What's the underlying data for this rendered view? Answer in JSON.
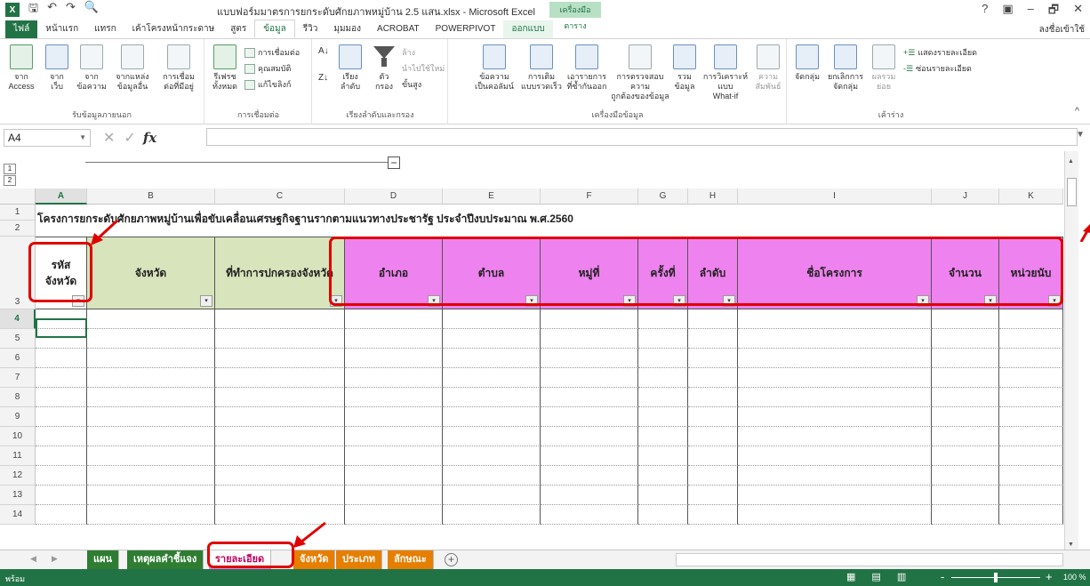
{
  "window": {
    "title": "แบบฟอร์มมาตรการยกระดับศักยภาพหมู่บ้าน 2.5 แสน.xlsx - Microsoft Excel",
    "context_group": "เครื่องมือตาราง",
    "help": "?",
    "minimize": "–",
    "restore": "🗗",
    "close": "✕"
  },
  "tabs": {
    "file": "ไฟล์",
    "items": [
      "หน้าแรก",
      "แทรก",
      "เค้าโครงหน้ากระดาษ",
      "สูตร",
      "ข้อมูล",
      "รีวิว",
      "มุมมอง",
      "ACROBAT",
      "POWERPIVOT",
      "ออกแบบ"
    ],
    "signin": "ลงชื่อเข้าใช้"
  },
  "ribbon": {
    "get_external": {
      "label": "รับข้อมูลภายนอก",
      "buttons": [
        "จาก\nAccess",
        "จาก\nเว็บ",
        "จาก\nข้อความ",
        "จากแหล่ง\nข้อมูลอื่น",
        "การเชื่อม\nต่อที่มีอยู่"
      ]
    },
    "connections": {
      "label": "การเชื่อมต่อ",
      "refresh": "รีเฟรช\nทั้งหมด",
      "items": [
        "การเชื่อมต่อ",
        "คุณสมบัติ",
        "แก้ไขลิงก์"
      ]
    },
    "sort_filter": {
      "label": "เรียงลำดับและกรอง",
      "sort": "เรียง\nลำดับ",
      "filter": "ตัว\nกรอง",
      "items": [
        "ล้าง",
        "นำไปใช้ใหม่",
        "ขั้นสูง"
      ]
    },
    "data_tools": {
      "label": "เครื่องมือข้อมูล",
      "buttons": [
        "ข้อความ\nเป็นคอลัมน์",
        "การเติม\nแบบรวดเร็ว",
        "เอารายการ\nที่ซ้ำกันออก",
        "การตรวจสอบความ\nถูกต้องของข้อมูล",
        "รวม\nข้อมูล",
        "การวิเคราะห์แบบ\nWhat-if",
        "ความ\nสัมพันธ์"
      ]
    },
    "outline": {
      "label": "เค้าร่าง",
      "buttons": [
        "จัดกลุ่ม",
        "ยกเลิกการ\nจัดกลุ่ม",
        "ผลรวม\nย่อย"
      ],
      "items": [
        "แสดงรายละเอียด",
        "ซ่อนรายละเอียด"
      ]
    }
  },
  "formula_bar": {
    "name_box": "A4",
    "fx": "fx",
    "formula": ""
  },
  "outline_levels": [
    "1",
    "2"
  ],
  "sheet": {
    "columns": [
      "A",
      "B",
      "C",
      "D",
      "E",
      "F",
      "G",
      "H",
      "I",
      "J",
      "K"
    ],
    "rows": [
      "1",
      "2",
      "3",
      "4",
      "5",
      "6",
      "7",
      "8",
      "9",
      "10",
      "11",
      "12",
      "13",
      "14"
    ],
    "title": "โครงการยกระดับศักยภาพหมู่บ้านเพื่อขับเคลื่อนเศรษฐกิจฐานรากตามแนวทางประชารัฐ ประจำปีงบประมาณ พ.ศ.2560",
    "headers": [
      "รหัส\nจังหวัด",
      "จังหวัด",
      "ที่ทำการปกครองจังหวัด",
      "อำเภอ",
      "ตำบล",
      "หมู่ที่",
      "ครั้งที่",
      "ลำดับ",
      "ชื่อโครงการ",
      "จำนวน",
      "หน่วยนับ"
    ],
    "filter_glyph": "▾"
  },
  "sheet_tabs": [
    {
      "label": "แผน",
      "color": "#2e7d32"
    },
    {
      "label": "เหตุผลคำชี้แจง",
      "color": "#2e7d32"
    },
    {
      "label": "รายละเอียด",
      "color": "#ee82ee",
      "active": true
    },
    {
      "label": "จังหวัด",
      "color": "#e67e00"
    },
    {
      "label": "ประเภท",
      "color": "#e67e00"
    },
    {
      "label": "ลักษณะ",
      "color": "#e67e00"
    }
  ],
  "add_sheet": "+",
  "status": {
    "ready": "พร้อม",
    "zoom": "100 %",
    "zoom_minus": "-",
    "zoom_plus": "+"
  },
  "colors": {
    "excel_green": "#217346",
    "header_green": "#d8e4bc",
    "header_pink": "#ee82ee",
    "annotation_red": "#e00000"
  }
}
